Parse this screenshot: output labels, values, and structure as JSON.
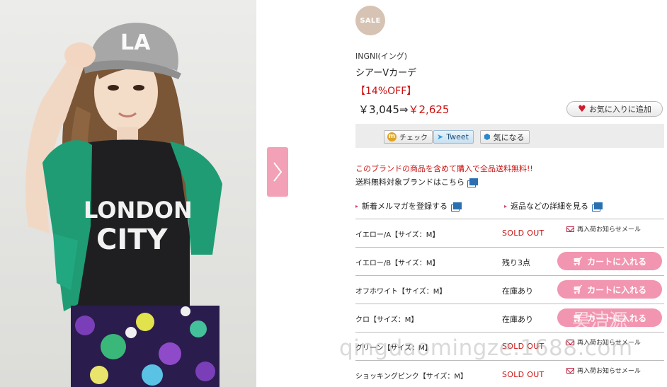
{
  "product_image": {
    "cap_text": "LA",
    "shirt_text_line1": "LONDON",
    "shirt_text_line2": "CITY"
  },
  "badge": {
    "label": "SALE"
  },
  "product": {
    "brand": "INGNI(イング)",
    "name": "シアーVカーデ",
    "discount": "【14%OFF】",
    "price_original": "￥3,045⇒",
    "price_sale": "￥2,625"
  },
  "favorite": {
    "label": "お気に入りに追加"
  },
  "social": {
    "check_label": "チェック",
    "tweet_label": "Tweet",
    "kininaru_label": "気になる"
  },
  "promo": {
    "text": "このブランドの商品を含めて購入で全品送料無料!!",
    "link": "送料無料対象ブランドはこちら"
  },
  "links": {
    "mailmag": "新着メルマガを登録する",
    "returns": "返品などの詳細を見る"
  },
  "variants": [
    {
      "name": "イエロー/A【サイズ：M】",
      "stock": "SOLD OUT",
      "action": "再入荷お知らせメール"
    },
    {
      "name": "イエロー/B【サイズ：M】",
      "stock": "残り3点",
      "action": "カートに入れる"
    },
    {
      "name": "オフホワイト【サイズ：M】",
      "stock": "在庫あり",
      "action": "カートに入れる"
    },
    {
      "name": "クロ【サイズ：M】",
      "stock": "在庫あり",
      "action": "カートに入れる"
    },
    {
      "name": "グリーン【サイズ：M】",
      "stock": "SOLD OUT",
      "action": "再入荷お知らせメール"
    },
    {
      "name": "ショッキングピンク【サイズ：M】",
      "stock": "SOLD OUT",
      "action": "再入荷お知らせメール"
    }
  ],
  "watermark": {
    "text": "qingdaomingze.1688.com",
    "overlay": "昊洁源"
  },
  "colors": {
    "accent_red": "#cc1111",
    "cart_pink": "#f295b0",
    "sale_badge": "#d6c3b3"
  }
}
